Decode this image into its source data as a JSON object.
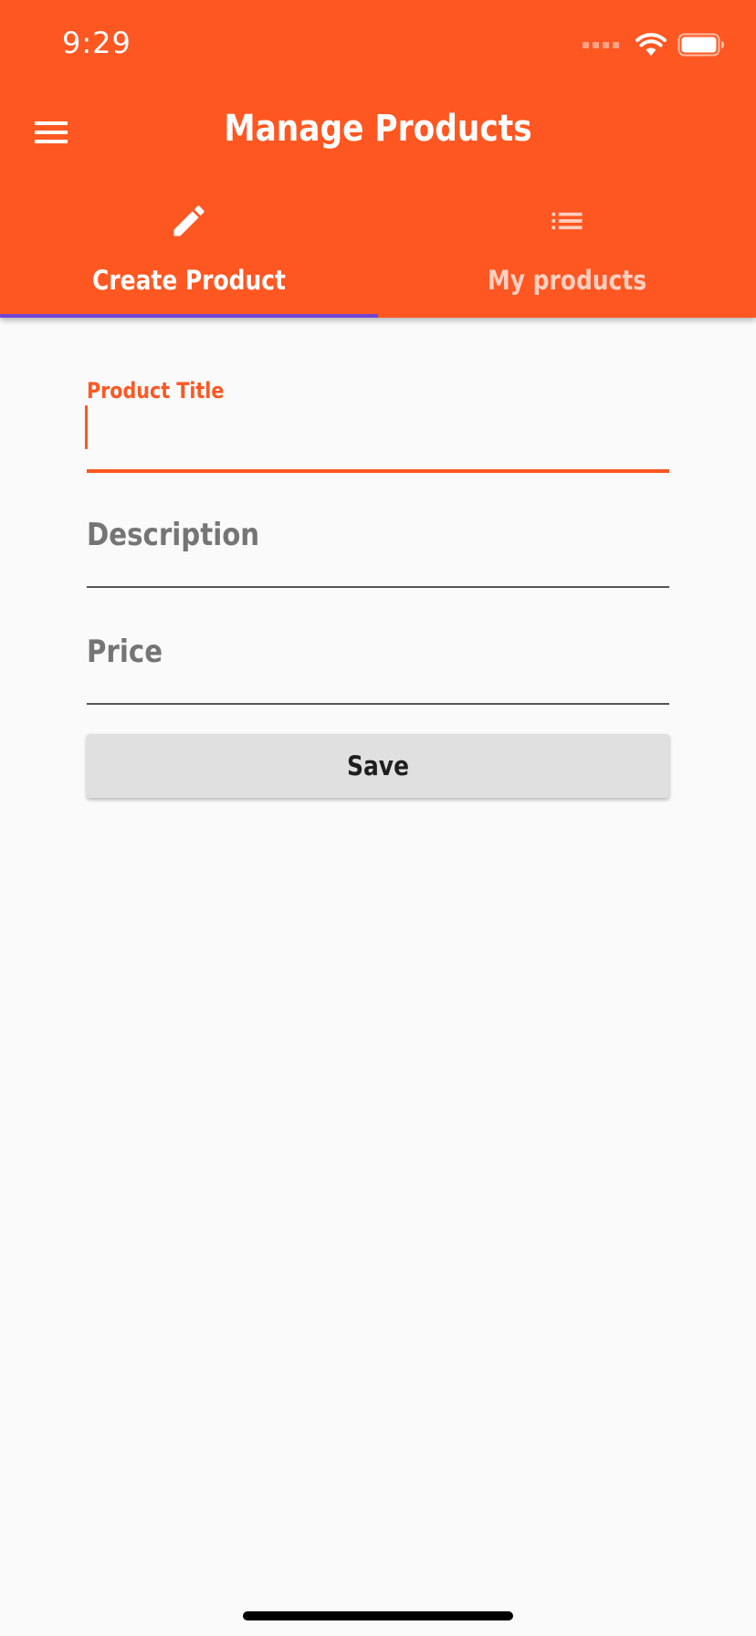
{
  "status_bar": {
    "time": "9:29",
    "icons": [
      "cellular-signal-icon",
      "wifi-icon",
      "battery-icon"
    ]
  },
  "app_bar": {
    "menu_icon": "hamburger-menu-icon",
    "title": "Manage Products"
  },
  "tabs": [
    {
      "label": "Create Product",
      "icon": "pencil-icon",
      "active": true
    },
    {
      "label": "My products",
      "icon": "list-icon",
      "active": false
    }
  ],
  "form": {
    "title_field": {
      "label": "Product Title",
      "value": ""
    },
    "description_field": {
      "label": "Description",
      "value": ""
    },
    "price_field": {
      "label": "Price",
      "value": ""
    },
    "save_label": "Save"
  },
  "colors": {
    "primary": "#ff5722",
    "tab_indicator": "#7046d3",
    "background": "#fafafa",
    "button": "#e0e0e0",
    "label_inactive": "#757575"
  }
}
